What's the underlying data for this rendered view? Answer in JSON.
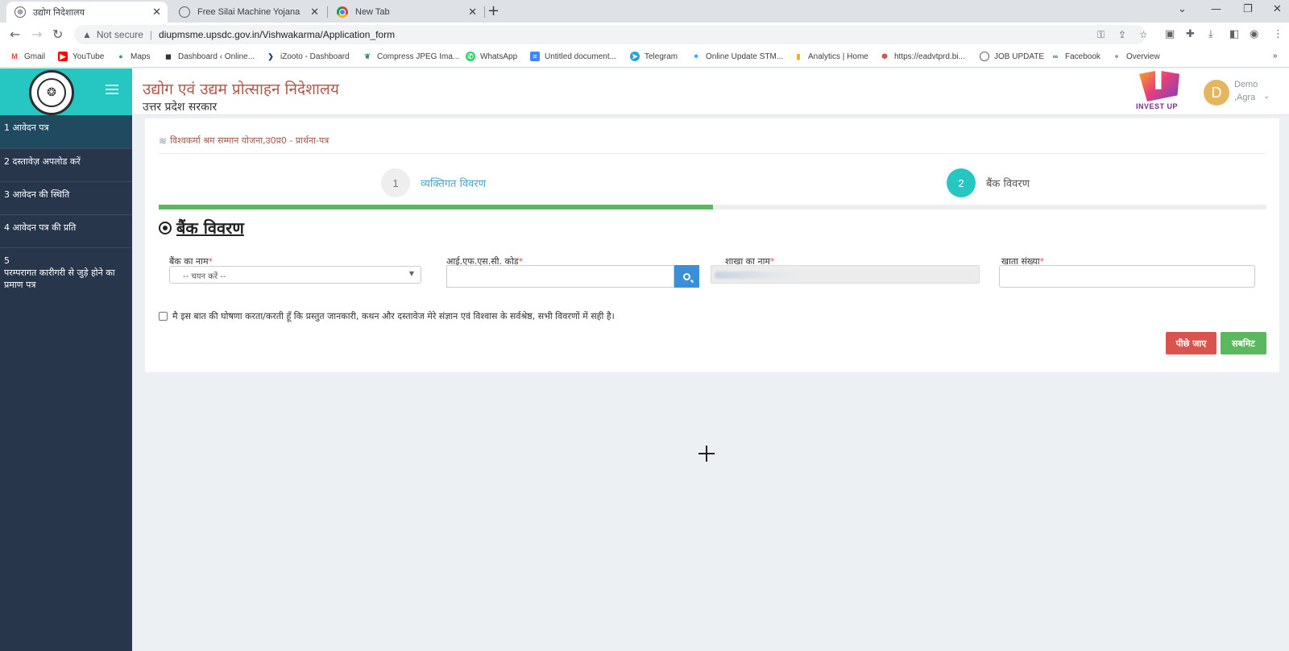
{
  "browser": {
    "tabs": [
      {
        "title": "उद्योग निदेशालय",
        "active": true
      },
      {
        "title": "Free Silai Machine Yojana",
        "active": false
      },
      {
        "title": "New Tab",
        "active": false
      }
    ],
    "address": {
      "security": "Not secure",
      "url": "diupmsme.upsdc.gov.in/Vishwakarma/Application_form"
    },
    "bookmarks": [
      "Gmail",
      "YouTube",
      "Maps",
      "Dashboard ‹ Online...",
      "iZooto - Dashboard",
      "Compress JPEG Ima...",
      "WhatsApp",
      "Untitled document...",
      "Telegram",
      "Online Update STM...",
      "Analytics | Home",
      "https://eadvtprd.bi...",
      "JOB UPDATE",
      "Facebook",
      "Overview"
    ]
  },
  "sidebar": {
    "items": [
      {
        "num": "1",
        "label": "आवेदन पत्र"
      },
      {
        "num": "2",
        "label": "दस्तावेज़ अपलोड करें"
      },
      {
        "num": "3",
        "label": "आवेदन की स्थिति"
      },
      {
        "num": "4",
        "label": "आवेदन पत्र की प्रति"
      },
      {
        "num": "5",
        "label": "परम्परागत कारीगरी से जुड़े होने का प्रमाण पत्र"
      }
    ]
  },
  "header": {
    "org_title": "उद्योग एवं उद्यम प्रोत्साहन निदेशालय",
    "org_subtitle": "उत्तर प्रदेश सरकार",
    "logo_text": "INVEST UP",
    "avatar_letter": "D",
    "user_name": "Demo",
    "user_city": ",Agra"
  },
  "form": {
    "breadcrumb": "विश्वकर्मा श्रम सम्मान योजना,उ0प्र0 - प्रार्थना-पत्र",
    "steps": [
      {
        "num": "1",
        "label": "व्यक्तिगत विवरण"
      },
      {
        "num": "2",
        "label": "बैंक विवरण"
      }
    ],
    "progress_percent": 50,
    "section_title": "बैंक विवरण",
    "fields": {
      "bank_name": {
        "label": "बैंक का नाम",
        "placeholder": "-- चयन करें --"
      },
      "ifsc": {
        "label": "आई.एफ.एस.सी. कोड",
        "value": ""
      },
      "branch": {
        "label": "शाखा का नाम"
      },
      "account": {
        "label": "खाता संख्या",
        "value": ""
      }
    },
    "required_mark": "*",
    "declaration": "मै इस बात की घोषणा करता/करती हूँ कि प्रस्तुत जानकारी, कथन और दस्तावेज मेरे संज्ञान एवं विश्वास के सर्वश्रेष्ठ, सभी विवरणों में सही है।",
    "back_label": "पीछे जाए",
    "submit_label": "सबमिट"
  },
  "colors": {
    "teal": "#26c6c3",
    "sidebar": "#27364b",
    "green": "#5cb85c",
    "red": "#d9534f",
    "title": "#b0584a"
  }
}
